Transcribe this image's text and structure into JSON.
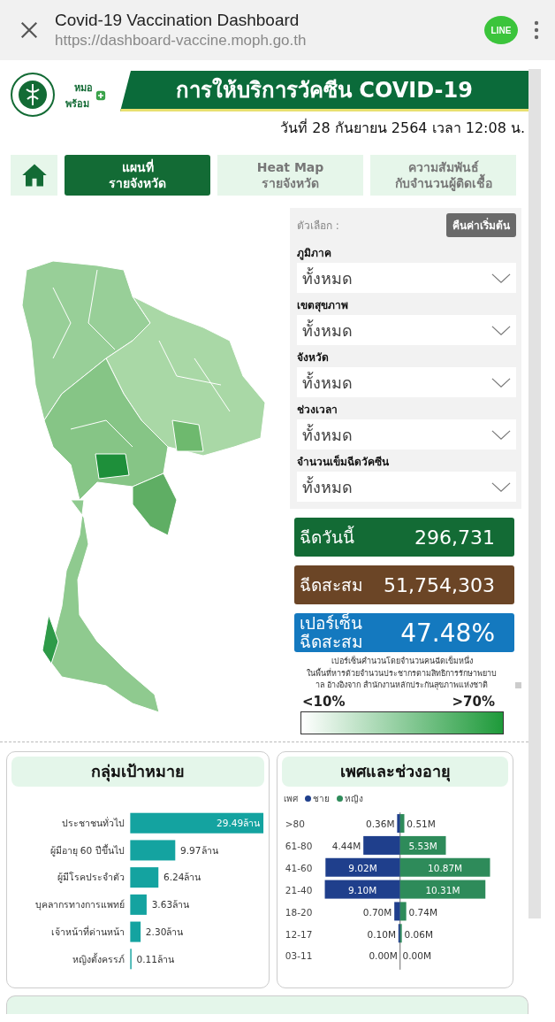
{
  "browser": {
    "title": "Covid-19 Vaccination Dashboard",
    "url": "https://dashboard-vaccine.moph.go.th",
    "share_badge": "LINE"
  },
  "header": {
    "logo_text": [
      "หมอ",
      "พร้อม"
    ],
    "title": "การให้บริการวัคซีน COVID-19",
    "updated": "วันที่ 28 กันยายน 2564 เวลา 12:08 น."
  },
  "tabs": [
    {
      "kind": "home",
      "selected": false
    },
    {
      "kind": "text",
      "label": "แผนที่\nรายจังหวัด",
      "selected": true
    },
    {
      "kind": "text",
      "label": "Heat Map\nรายจังหวัด",
      "selected": false
    },
    {
      "kind": "text",
      "label": "ความสัมพันธ์\nกับจำนวนผู้ติดเชื้อ",
      "selected": false
    }
  ],
  "filters": {
    "title": "ตัวเลือก :",
    "reset_button": "คืนค่าเริ่มต้น",
    "dropdowns": [
      {
        "label": "ภูมิภาค",
        "value": "ทั้งหมด"
      },
      {
        "label": "เขตสุขภาพ",
        "value": "ทั้งหมด"
      },
      {
        "label": "จังหวัด",
        "value": "ทั้งหมด"
      },
      {
        "label": "ช่วงเวลา",
        "value": "ทั้งหมด"
      },
      {
        "label": "จำนวนเข็มฉีดวัคซีน",
        "value": "ทั้งหมด"
      }
    ]
  },
  "stats": [
    {
      "label": "ฉีดวันนี้",
      "value": "296,731",
      "color": "#136b35"
    },
    {
      "label": "ฉีดสะสม",
      "value": "51,754,303",
      "color": "#6b4526"
    },
    {
      "label": "เปอร์เซ็น\nฉีดสะสม",
      "value": "47.48%",
      "color": "#1479bf"
    }
  ],
  "note": "เปอร์เซ็นคำนวนโดยจำนวนคนฉีดเข็มหนึ่ง\nในพื้นที่หารด้วยจำนวนประชากรตามสิทธิการรักษาพยาบ\nาล อ้างอิงจาก สำนักงานหลักประกันสุขภาพแห่งชาติ",
  "legend": {
    "low": "<10%",
    "high": ">70%"
  },
  "target_groups": {
    "title": "กลุ่มเป้าหมาย",
    "chart_data": {
      "type": "bar",
      "orientation": "horizontal",
      "categories": [
        "ประชาชนทั่วไป",
        "ผู้มีอายุ 60 ปีขึ้นไป",
        "ผู้มีโรคประจำตัว",
        "บุคลากรทางการแพทย์",
        "เจ้าหน้าที่ด่านหน้า",
        "หญิงตั้งครรภ์"
      ],
      "values": [
        29.49,
        9.97,
        6.24,
        3.63,
        2.3,
        0.11
      ],
      "data_labels": true,
      "value_labels": [
        "29.49ล้าน",
        "9.97ล้าน",
        "6.24ล้าน",
        "3.63ล้าน",
        "2.30ล้าน",
        "0.11ล้าน"
      ]
    }
  },
  "sex_age": {
    "title": "เพศและช่วงอายุ",
    "legend_title": "เพศ",
    "male": {
      "chart_data": {
        "type": "bar",
        "orientation": "horizontal",
        "categories": [
          ">80",
          "61-80",
          "41-60",
          "21-40",
          "18-20",
          "12-17",
          "03-11"
        ],
        "data_labels": true,
        "series": [
          {
            "name": "ชาย",
            "color": "#1f3f8c",
            "values": [
              0.36,
              4.44,
              9.02,
              9.1,
              0.7,
              0.1,
              0.0
            ],
            "value_labels": [
              "0.36M",
              "4.44M",
              "9.02M",
              "9.10M",
              "0.70M",
              "0.10M",
              "0.00M"
            ]
          }
        ]
      }
    },
    "female": {
      "chart_data": {
        "type": "bar",
        "orientation": "horizontal",
        "data_labels": true,
        "series": [
          {
            "name": "หญิง",
            "color": "#2e8b5a",
            "values": [
              0.51,
              5.53,
              10.87,
              10.31,
              0.74,
              0.06,
              0.0
            ],
            "value_labels": [
              "0.51M",
              "5.53M",
              "10.87M",
              "10.31M",
              "0.74M",
              "0.06M",
              "0.00M"
            ]
          }
        ]
      }
    }
  }
}
